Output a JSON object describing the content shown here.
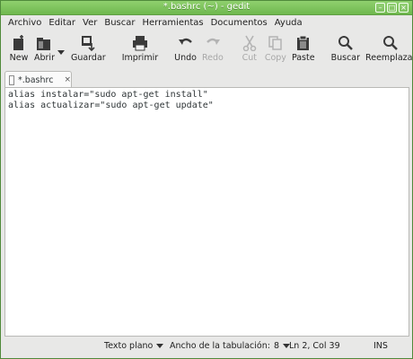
{
  "window": {
    "title": "*.bashrc (~) - gedit",
    "controls": [
      "–",
      "□",
      "×"
    ]
  },
  "menu": [
    "Archivo",
    "Editar",
    "Ver",
    "Buscar",
    "Herramientas",
    "Documentos",
    "Ayuda"
  ],
  "toolbar": {
    "new": "New",
    "open": "Abrir",
    "save": "Guardar",
    "print": "Imprimir",
    "undo": "Undo",
    "redo": "Redo",
    "cut": "Cut",
    "copy": "Copy",
    "paste": "Paste",
    "find": "Buscar",
    "replace": "Reemplazar"
  },
  "tab": {
    "name": "*.bashrc",
    "close": "×"
  },
  "editor": {
    "lines": [
      "alias instalar=\"sudo apt-get install\"",
      "alias actualizar=\"sudo apt-get update\""
    ]
  },
  "status": {
    "syntax": "Texto plano",
    "tab_width_label": "Ancho de la tabulación:",
    "tab_width": "8",
    "position": "Ln 2, Col 39",
    "mode": "INS"
  }
}
